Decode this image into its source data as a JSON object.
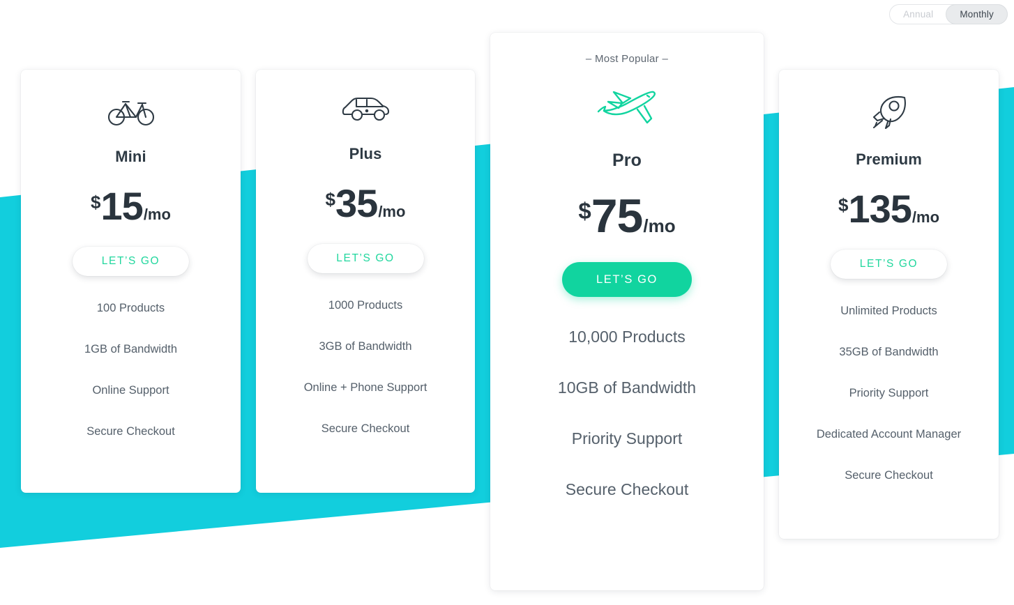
{
  "billing_toggle": {
    "annual_label": "Annual",
    "monthly_label": "Monthly",
    "selected": "Monthly"
  },
  "theme": {
    "cyan": "#12cedd",
    "green": "#11d49f",
    "ink": "#2a343d",
    "muted": "#55606b"
  },
  "plans": [
    {
      "icon": "bicycle-icon",
      "name": "Mini",
      "currency": "$",
      "amount": "15",
      "period": "/mo",
      "cta": "LET’S GO",
      "featured": false,
      "features": [
        "100 Products",
        "1GB of Bandwidth",
        "Online Support",
        "Secure Checkout"
      ]
    },
    {
      "icon": "car-icon",
      "name": "Plus",
      "currency": "$",
      "amount": "35",
      "period": "/mo",
      "cta": "LET’S GO",
      "featured": false,
      "features": [
        "1000 Products",
        "3GB of Bandwidth",
        "Online + Phone Support",
        "Secure Checkout"
      ]
    },
    {
      "icon": "airplane-icon",
      "name": "Pro",
      "badge": "– Most Popular –",
      "currency": "$",
      "amount": "75",
      "period": "/mo",
      "cta": "LET’S GO",
      "featured": true,
      "features": [
        "10,000 Products",
        "10GB of Bandwidth",
        "Priority Support",
        "Secure Checkout"
      ]
    },
    {
      "icon": "rocket-icon",
      "name": "Premium",
      "currency": "$",
      "amount": "135",
      "period": "/mo",
      "cta": "LET’S GO",
      "featured": false,
      "features": [
        "Unlimited Products",
        "35GB of Bandwidth",
        "Priority Support",
        "Dedicated Account Manager",
        "Secure Checkout"
      ]
    }
  ]
}
